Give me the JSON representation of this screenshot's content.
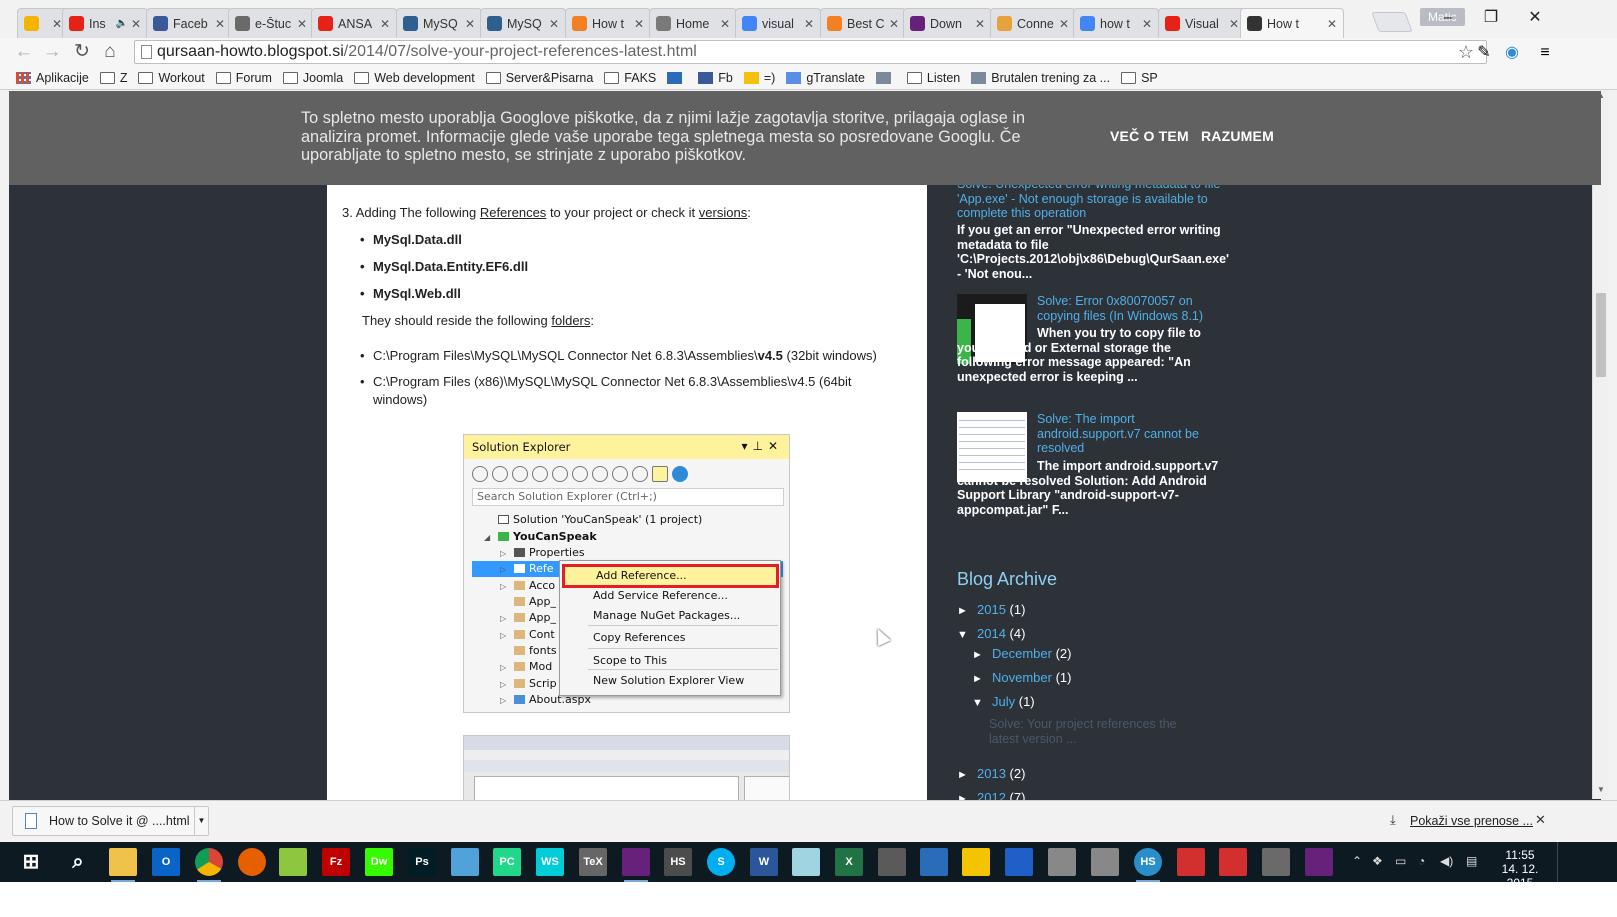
{
  "tabs": [
    {
      "title": "",
      "icon": "keep-icon",
      "color": "#f4b400",
      "active": false
    },
    {
      "title": "Ins",
      "icon": "youtube-icon",
      "color": "#e62117",
      "active": false,
      "muted": true
    },
    {
      "title": "Faceb",
      "icon": "facebook-icon",
      "color": "#3b5998",
      "active": false
    },
    {
      "title": "e-Štuc",
      "icon": "moodle-icon",
      "color": "#6a6a6a",
      "active": false
    },
    {
      "title": "ANSA",
      "icon": "youtube-icon",
      "color": "#e62117",
      "active": false
    },
    {
      "title": "MySQ",
      "icon": "mysql-icon",
      "color": "#2f5f8f",
      "active": false
    },
    {
      "title": "MySQ",
      "icon": "mysql-icon",
      "color": "#2f5f8f",
      "active": false
    },
    {
      "title": "How t",
      "icon": "stackoverflow-icon",
      "color": "#f48024",
      "active": false
    },
    {
      "title": "Home",
      "icon": "page-icon",
      "color": "#7a7a7a",
      "active": false
    },
    {
      "title": "visual",
      "icon": "google-icon",
      "color": "#4285f4",
      "active": false
    },
    {
      "title": "Best C",
      "icon": "stackoverflow-icon",
      "color": "#f48024",
      "active": false
    },
    {
      "title": "Down",
      "icon": "vs-icon",
      "color": "#68217a",
      "active": false
    },
    {
      "title": "Conne",
      "icon": "connect-icon",
      "color": "#e6a23c",
      "active": false
    },
    {
      "title": "how t",
      "icon": "google-icon",
      "color": "#4285f4",
      "active": false
    },
    {
      "title": "Visual",
      "icon": "youtube-icon",
      "color": "#e62117",
      "active": false
    },
    {
      "title": "How t",
      "icon": "blogger-icon",
      "color": "#333333",
      "active": true
    }
  ],
  "profile_name": "Matic",
  "url": {
    "host": "qursaan-howto.blogspot.si",
    "path": "/2014/07/solve-your-project-references-latest.html"
  },
  "bookmarks": [
    {
      "label": "Aplikacije",
      "icon": "apps-icon"
    },
    {
      "label": "Z",
      "icon": "folder-icon"
    },
    {
      "label": "Workout",
      "icon": "folder-icon"
    },
    {
      "label": "Forum",
      "icon": "folder-icon"
    },
    {
      "label": "Joomla",
      "icon": "folder-icon"
    },
    {
      "label": "Web development",
      "icon": "folder-icon"
    },
    {
      "label": "Server&Pisarna",
      "icon": "folder-icon"
    },
    {
      "label": "FAKS",
      "icon": "folder-icon"
    },
    {
      "label": "",
      "icon": "calendar-icon"
    },
    {
      "label": "Fb",
      "icon": "facebook-icon"
    },
    {
      "label": "=)",
      "icon": "smile-icon"
    },
    {
      "label": "gTranslate",
      "icon": "translate-icon"
    },
    {
      "label": "",
      "icon": "tuning-fork-icon"
    },
    {
      "label": "Listen",
      "icon": "folder-icon"
    },
    {
      "label": "Brutalen trening za ...",
      "icon": "runner-icon"
    },
    {
      "label": "SP",
      "icon": "folder-icon"
    }
  ],
  "cookie": {
    "text": "To spletno mesto uporablja Googlove piškotke, da z njimi lažje zagotavlja storitve, prilagaja oglase in analizira promet. Informacije glede vaše uporabe tega spletnega mesta so posredovane Googlu. Če uporabljate to spletno mesto, se strinjate z uporabo piškotkov.",
    "more_label": "VEČ O TEM",
    "accept_label": "RAZUMEM"
  },
  "post": {
    "step_number": "3.",
    "step_pre": "Adding The following",
    "step_link1": "References",
    "step_mid": "to your project or check it",
    "step_link2": "versions",
    "step_end": ":",
    "dlls": [
      "MySql.Data.dll",
      "MySql.Data.Entity.EF6.dll",
      "MySql.Web.dll"
    ],
    "reside_pre": "They should reside the following",
    "reside_link": "folders",
    "reside_end": ":",
    "path1_pre": "C:\\Program Files\\MySQL\\MySQL Connector Net 6.8.3\\Assemblies\\",
    "path1_bold": "v4.5",
    "path1_end": " (32bit windows)",
    "path2": "C:\\Program Files (x86)\\MySQL\\MySQL Connector Net 6.8.3\\Assemblies\\v4.5 (64bit windows)"
  },
  "solution_explorer": {
    "title": "Solution Explorer",
    "search_placeholder": "Search Solution Explorer (Ctrl+;)",
    "tree": [
      {
        "label": "Solution 'YouCanSpeak' (1 project)",
        "bold": false,
        "selected": false
      },
      {
        "label": "YouCanSpeak",
        "bold": true,
        "selected": false
      },
      {
        "label": "Properties",
        "bold": false,
        "selected": false
      },
      {
        "label": "Refe",
        "bold": false,
        "selected": true
      },
      {
        "label": "Acco",
        "bold": false,
        "selected": false
      },
      {
        "label": "App_",
        "bold": false,
        "selected": false
      },
      {
        "label": "App_",
        "bold": false,
        "selected": false
      },
      {
        "label": "Cont",
        "bold": false,
        "selected": false
      },
      {
        "label": "fonts",
        "bold": false,
        "selected": false
      },
      {
        "label": "Mod",
        "bold": false,
        "selected": false
      },
      {
        "label": "Scrip",
        "bold": false,
        "selected": false
      },
      {
        "label": "About.aspx",
        "bold": false,
        "selected": false
      }
    ],
    "context_menu": [
      "Add Reference...",
      "Add Service Reference...",
      "Manage NuGet Packages...",
      "Copy References",
      "Scope to This",
      "New Solution Explorer View"
    ]
  },
  "sidebar": {
    "post1_title": "Solve: Unexpected error writing metadata to file 'App.exe' - Not enough storage is available to complete this operation",
    "post1_body": "If you get an error  \"Unexpected error writing metadata to file 'C:\\Projects.2012\\obj\\x86\\Debug\\QurSaan.exe' - 'Not enou...",
    "post2_title": "Solve: Error 0x80070057 on copying files (In Windows 8.1)",
    "post2_body": "When you try to copy file to your SDcard or External storage the following error message appeared: \"An unexpected error is keeping ...",
    "post3_title": "Solve: The import android.support.v7 cannot be resolved",
    "post3_body": "The import android.support.v7 cannot be resolved Solution: Add Android Support Library \"android-support-v7-appcompat.jar\" F...",
    "archive_title": "Blog Archive",
    "archive": [
      {
        "tri": "►",
        "label": "2015",
        "count": "(1)"
      },
      {
        "tri": "▼",
        "label": "2014",
        "count": "(4)"
      },
      {
        "tri": "►",
        "label": "December",
        "count": "(2)"
      },
      {
        "tri": "►",
        "label": "November",
        "count": "(1)"
      },
      {
        "tri": "▼",
        "label": "July",
        "count": "(1)"
      },
      {
        "tri": "►",
        "label": "2013",
        "count": "(2)"
      },
      {
        "tri": "►",
        "label": "2012",
        "count": "(7)"
      }
    ],
    "archive_post": "Solve: Your project references the latest version ..."
  },
  "download": {
    "filename": "How to Solve it @ ....html",
    "show_all": "Pokaži vse prenose ..."
  },
  "taskbar": {
    "apps": [
      {
        "icon": "start-icon",
        "color": "#0e1a22",
        "label": ""
      },
      {
        "icon": "search-icon",
        "color": "#0e1a22",
        "label": ""
      },
      {
        "icon": "file-explorer-icon",
        "color": "#f0c24a",
        "label": ""
      },
      {
        "icon": "outlook-icon",
        "color": "#0a64c8",
        "label": "O"
      },
      {
        "icon": "chrome-icon",
        "color": "#db4437",
        "label": ""
      },
      {
        "icon": "firefox-icon",
        "color": "#e66000",
        "label": ""
      },
      {
        "icon": "notepadpp-icon",
        "color": "#8dc63f",
        "label": ""
      },
      {
        "icon": "filezilla-icon",
        "color": "#bf0000",
        "label": "Fz"
      },
      {
        "icon": "dreamweaver-icon",
        "color": "#35fa00",
        "label": "Dw"
      },
      {
        "icon": "photoshop-icon",
        "color": "#001d26",
        "label": "Ps"
      },
      {
        "icon": "cube-icon",
        "color": "#4fa3d9",
        "label": ""
      },
      {
        "icon": "pycharm-icon",
        "color": "#21d789",
        "label": "PC"
      },
      {
        "icon": "webstorm-icon",
        "color": "#00cdd7",
        "label": "WS"
      },
      {
        "icon": "tex-icon",
        "color": "#666666",
        "label": "TeX"
      },
      {
        "icon": "visual-studio-icon",
        "color": "#68217a",
        "label": ""
      },
      {
        "icon": "hs-icon",
        "color": "#4c4c4c",
        "label": "HS"
      },
      {
        "icon": "skype-icon",
        "color": "#00aff0",
        "label": "S"
      },
      {
        "icon": "word-icon",
        "color": "#2b579a",
        "label": "W"
      },
      {
        "icon": "paper-icon",
        "color": "#9fd4e0",
        "label": ""
      },
      {
        "icon": "excel-icon",
        "color": "#217346",
        "label": "X"
      },
      {
        "icon": "calculator-icon",
        "color": "#5a5a5a",
        "label": ""
      },
      {
        "icon": "box-icon",
        "color": "#2a6cb8",
        "label": ""
      },
      {
        "icon": "sticky-icon",
        "color": "#f5c400",
        "label": ""
      },
      {
        "icon": "network-icon",
        "color": "#1e60c8",
        "label": ""
      },
      {
        "icon": "graduation-icon",
        "color": "#888888",
        "label": ""
      },
      {
        "icon": "computer-icon",
        "color": "#888888",
        "label": ""
      },
      {
        "icon": "hs-active-icon",
        "color": "#2a8fc9",
        "label": "HS"
      },
      {
        "icon": "pdf-icon",
        "color": "#d32f2f",
        "label": ""
      },
      {
        "icon": "chart-app-icon",
        "color": "#d32f2f",
        "label": ""
      },
      {
        "icon": "tools-icon",
        "color": "#6a6a6a",
        "label": ""
      },
      {
        "icon": "vs-icon",
        "color": "#68217a",
        "label": ""
      }
    ],
    "time": "11:55",
    "date": "14. 12. 2015"
  }
}
